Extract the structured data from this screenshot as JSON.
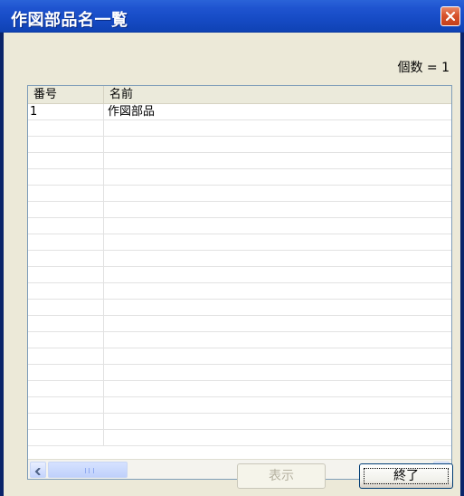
{
  "window": {
    "title": "作図部品名一覧"
  },
  "count": {
    "text": "個数 = 1"
  },
  "table": {
    "headers": [
      "番号",
      "名前"
    ],
    "rows": [
      [
        "1",
        "作図部品"
      ],
      [
        "",
        ""
      ],
      [
        "",
        ""
      ],
      [
        "",
        ""
      ],
      [
        "",
        ""
      ],
      [
        "",
        ""
      ],
      [
        "",
        ""
      ],
      [
        "",
        ""
      ],
      [
        "",
        ""
      ],
      [
        "",
        ""
      ],
      [
        "",
        ""
      ],
      [
        "",
        ""
      ],
      [
        "",
        ""
      ],
      [
        "",
        ""
      ],
      [
        "",
        ""
      ],
      [
        "",
        ""
      ],
      [
        "",
        ""
      ],
      [
        "",
        ""
      ],
      [
        "",
        ""
      ],
      [
        "",
        ""
      ],
      [
        "",
        ""
      ]
    ]
  },
  "buttons": {
    "show": "表示",
    "end": "終了"
  },
  "icons": {
    "close": "close-icon",
    "scroll_left": "arrow-left-icon",
    "scroll_right": "arrow-right-icon"
  }
}
